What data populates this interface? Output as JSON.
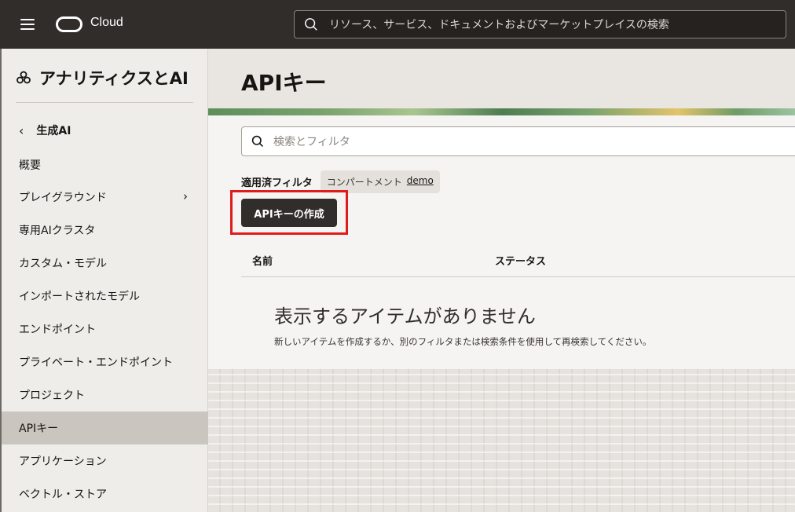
{
  "header": {
    "brand": "Cloud",
    "search_placeholder": "リソース、サービス、ドキュメントおよびマーケットプレイスの検索"
  },
  "sidebar": {
    "section_title": "アナリティクスとAI",
    "back_label": "生成AI",
    "items": [
      {
        "label": "概要"
      },
      {
        "label": "プレイグラウンド"
      },
      {
        "label": "専用AIクラスタ"
      },
      {
        "label": "カスタム・モデル"
      },
      {
        "label": "インポートされたモデル"
      },
      {
        "label": "エンドポイント"
      },
      {
        "label": "プライベート・エンドポイント"
      },
      {
        "label": "プロジェクト"
      },
      {
        "label": "APIキー"
      },
      {
        "label": "アプリケーション"
      },
      {
        "label": "ベクトル・ストア"
      }
    ],
    "active_item": "APIキー"
  },
  "main": {
    "title": "APIキー",
    "filter_placeholder": "検索とフィルタ",
    "applied_filters_label": "適用済フィルタ",
    "chip": {
      "key": "コンパートメント",
      "value": "demo"
    },
    "create_button": "APIキーの作成",
    "columns": [
      "名前",
      "ステータス"
    ],
    "empty_title": "表示するアイテムがありません",
    "empty_description": "新しいアイテムを作成するか、別のフィルタまたは検索条件を使用して再検索してください。"
  },
  "colors": {
    "header_bg": "#312d2a",
    "highlight": "#e01b1b",
    "active_nav": "#cac5bf"
  }
}
